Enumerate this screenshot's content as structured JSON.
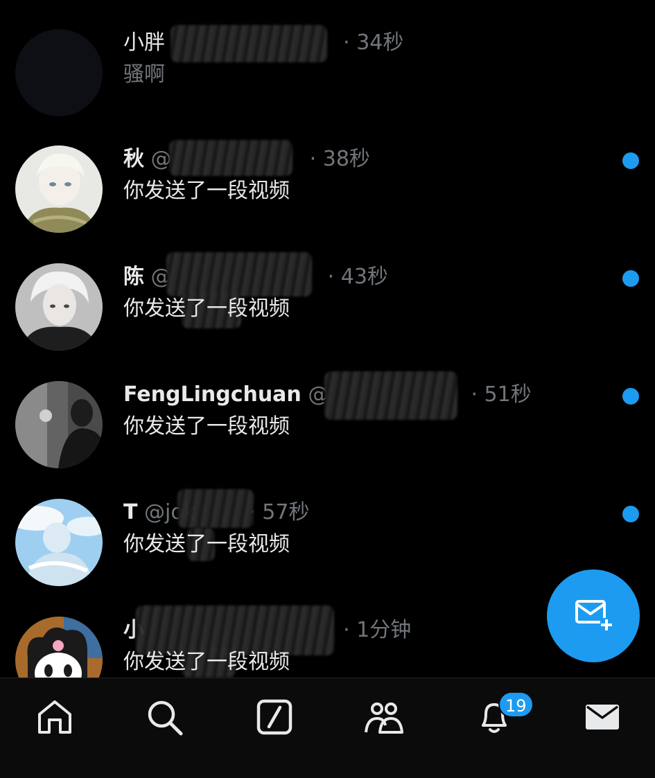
{
  "conversations": [
    {
      "name": "小胖",
      "handle": "",
      "time": "34秒",
      "preview": "骚啊",
      "unread": false
    },
    {
      "name": "秋",
      "handle": "@",
      "time": "38秒",
      "preview": "你发送了一段视频",
      "unread": true
    },
    {
      "name": "陈",
      "handle": "@",
      "time": "43秒",
      "preview": "你发送了一段视频",
      "unread": true
    },
    {
      "name": "FengLingchuan",
      "handle": "@",
      "time": "51秒",
      "preview": "你发送了一段视频",
      "unread": true
    },
    {
      "name": "T",
      "handle": "@jok",
      "time": "57秒",
      "preview": "你发送了一段视频",
      "unread": true
    },
    {
      "name": "小",
      "handle": "",
      "time": "1分钟",
      "preview": "你发送了一段视频",
      "unread": false
    }
  ],
  "dot_separator": "·",
  "notifications_badge": "19",
  "colors": {
    "accent": "#1d9bf0",
    "background": "#000000",
    "muted": "#71767b"
  }
}
